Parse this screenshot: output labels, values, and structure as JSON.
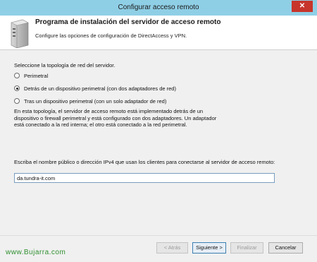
{
  "window": {
    "title": "Configurar acceso remoto",
    "close_glyph": "✕"
  },
  "header": {
    "title": "Programa de instalación del servidor de acceso remoto",
    "subtitle": "Configure las opciones de configuración de DirectAccess y VPN.",
    "icon": "server-icon"
  },
  "topology": {
    "heading": "Seleccione la topología de red del servidor.",
    "options": [
      {
        "label": "Perimetral",
        "selected": false
      },
      {
        "label": "Detrás de un dispositivo perimetral (con dos adaptadores de red)",
        "selected": true
      },
      {
        "label": "Tras un dispositivo perimetral (con un solo adaptador de red)",
        "selected": false
      }
    ],
    "description": "En esta topología, el servidor de acceso remoto está implementado detrás de un dispositivo o firewall perimetral y está configurado con dos adaptadores. Un adaptador está conectado a la red interna; el otro está conectado a la red perimetral."
  },
  "public_name": {
    "prompt": "Escriba el nombre público o dirección IPv4 que usan los clientes para conectarse al servidor de acceso remoto:",
    "value": "da.tundra-it.com"
  },
  "buttons": {
    "back": "< Atrás",
    "next": "Siguiente >",
    "finish": "Finalizar",
    "cancel": "Cancelar"
  },
  "watermark": "www.Bujarra.com",
  "colors": {
    "titlebar": "#8fcfe6",
    "close": "#c7352b",
    "watermark": "#2f8f2f"
  }
}
